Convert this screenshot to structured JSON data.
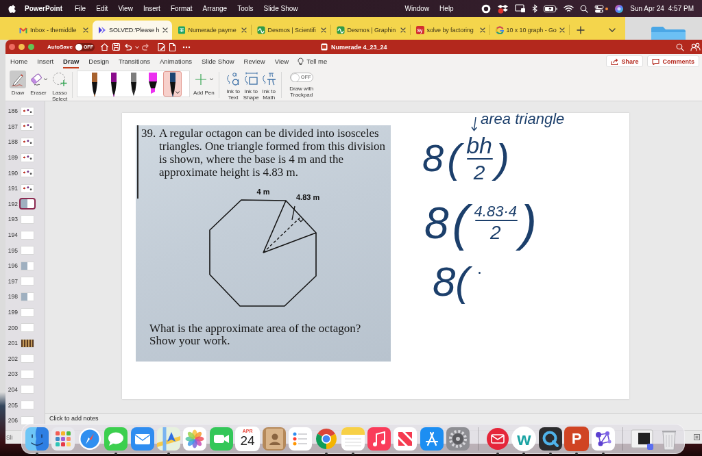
{
  "menubar": {
    "app": "PowerPoint",
    "menus": [
      "File",
      "Edit",
      "View",
      "Insert",
      "Format",
      "Arrange",
      "Tools",
      "Slide Show"
    ],
    "menus_right": [
      "Window",
      "Help"
    ],
    "clock": {
      "date": "Sun Apr 24",
      "time": "4:57 PM"
    }
  },
  "browser_tabs": [
    {
      "title": "Inbox - themiddle",
      "kind": "mail",
      "selected": false
    },
    {
      "title": "SOLVED:'Please h",
      "kind": "video",
      "selected": true
    },
    {
      "title": "Numerade payme",
      "kind": "sheet",
      "selected": false
    },
    {
      "title": "Desmos | Scientifi",
      "kind": "calculator",
      "selected": false
    },
    {
      "title": "Desmos | Graphin",
      "kind": "calculator",
      "selected": false
    },
    {
      "title": "solve by factoring",
      "kind": "badge",
      "badge": "Sy",
      "selected": false
    },
    {
      "title": "10 x 10 graph - Go",
      "kind": "search",
      "selected": false
    }
  ],
  "presentation": {
    "title": "Numerade 4_23_24",
    "autosave": {
      "label": "AutoSave",
      "on": false,
      "state_text": "OFF"
    },
    "ribbon_tabs": [
      {
        "label": "Home",
        "selected": false
      },
      {
        "label": "Insert",
        "selected": false
      },
      {
        "label": "Draw",
        "selected": true
      },
      {
        "label": "Design",
        "selected": false
      },
      {
        "label": "Transitions",
        "selected": false
      },
      {
        "label": "Animations",
        "selected": false
      },
      {
        "label": "Slide Show",
        "selected": false
      },
      {
        "label": "Review",
        "selected": false
      },
      {
        "label": "View",
        "selected": false
      }
    ],
    "tell_me": "Tell me",
    "share": "Share",
    "comments": "Comments",
    "tools": [
      {
        "kind": "draw",
        "label": "Draw",
        "selected": true
      },
      {
        "kind": "eraser",
        "label": "Eraser",
        "selected": false
      },
      {
        "kind": "lasso",
        "label": "Lasso Select",
        "selected": false
      }
    ],
    "pens": [
      {
        "kind": "pen",
        "color": "#a8622e",
        "selected": false
      },
      {
        "kind": "pen",
        "color": "#8a0b8c",
        "selected": false
      },
      {
        "kind": "pencil",
        "color": "#7d7d7d",
        "selected": false
      },
      {
        "kind": "highlighter",
        "color": "#ec2ff0",
        "selected": false
      },
      {
        "kind": "pen",
        "color": "#1d4471",
        "selected": true
      }
    ],
    "add_pen": "Add Pen",
    "ink_tools": [
      {
        "kind": "text",
        "label": "Ink to Text"
      },
      {
        "kind": "shape",
        "label": "Ink to Shape"
      },
      {
        "kind": "math",
        "label": "Ink to Math"
      }
    ],
    "trackpad": {
      "on": false,
      "state_text": "OFF",
      "label": "Draw with Trackpad"
    },
    "thumbnails": [
      {
        "number": "186",
        "kind": "picture",
        "selected": false
      },
      {
        "number": "187",
        "kind": "picture",
        "selected": false
      },
      {
        "number": "188",
        "kind": "picture",
        "selected": false
      },
      {
        "number": "189",
        "kind": "picture",
        "selected": false
      },
      {
        "number": "190",
        "kind": "picture",
        "selected": false
      },
      {
        "number": "191",
        "kind": "picture",
        "selected": false
      },
      {
        "number": "192",
        "kind": "worksheet",
        "selected": true
      },
      {
        "number": "193",
        "kind": "blank",
        "selected": false
      },
      {
        "number": "194",
        "kind": "blank",
        "selected": false
      },
      {
        "number": "195",
        "kind": "blank",
        "selected": false
      },
      {
        "number": "196",
        "kind": "worksheet",
        "selected": false
      },
      {
        "number": "197",
        "kind": "blank",
        "selected": false
      },
      {
        "number": "198",
        "kind": "worksheet",
        "selected": false
      },
      {
        "number": "199",
        "kind": "blank",
        "selected": false
      },
      {
        "number": "200",
        "kind": "blank",
        "selected": false
      },
      {
        "number": "201",
        "kind": "photo",
        "selected": false
      },
      {
        "number": "202",
        "kind": "blank",
        "selected": false
      },
      {
        "number": "203",
        "kind": "blank",
        "selected": false
      },
      {
        "number": "204",
        "kind": "blank",
        "selected": false
      },
      {
        "number": "205",
        "kind": "blank",
        "selected": false
      },
      {
        "number": "206",
        "kind": "blank",
        "selected": false
      }
    ],
    "slide": {
      "worksheet": {
        "number": "39.",
        "question": "A regular octagon can be divided into isosceles triangles. One triangle formed from this division is shown, where the base is 4 m and the approximate height is 4.83 m.",
        "base_label": "4 m",
        "height_label": "4.83 m",
        "prompt": "What is the approximate area of the octagon? Show your work."
      },
      "ink": [
        {
          "kind": "note",
          "text": "area triangle"
        },
        {
          "kind": "fraction",
          "factor": "8",
          "open": "(",
          "numerator": "bh",
          "denominator": "2",
          "close": ")"
        },
        {
          "kind": "fraction",
          "factor": "8",
          "open": "(",
          "numerator": "4.83·4",
          "denominator": "2",
          "close": ")"
        },
        {
          "kind": "text",
          "text": "8(",
          "trailing_dot": true
        }
      ]
    },
    "notes_placeholder": "Click to add notes",
    "status": "Sli"
  },
  "dock": [
    {
      "kind": "finder",
      "running": true
    },
    {
      "kind": "launchpad",
      "running": false
    },
    {
      "kind": "safari",
      "running": false
    },
    {
      "kind": "messages",
      "running": true
    },
    {
      "kind": "mail",
      "running": false
    },
    {
      "kind": "maps",
      "running": true
    },
    {
      "kind": "photos",
      "running": false
    },
    {
      "kind": "facetime",
      "running": false
    },
    {
      "kind": "calendar",
      "month": "APR",
      "day": "24",
      "running": false
    },
    {
      "kind": "contacts",
      "running": false
    },
    {
      "kind": "reminders",
      "running": false
    },
    {
      "kind": "browser",
      "running": true
    },
    {
      "kind": "notes",
      "running": true
    },
    {
      "kind": "music",
      "running": false
    },
    {
      "kind": "news",
      "running": false
    },
    {
      "kind": "appstore",
      "running": false
    },
    {
      "kind": "settings",
      "running": false
    },
    {
      "kind": "separator"
    },
    {
      "kind": "mailclient",
      "running": true
    },
    {
      "kind": "roundel",
      "letter": "w",
      "running": true
    },
    {
      "kind": "player",
      "running": true
    },
    {
      "kind": "tile",
      "letter": "P",
      "running": true
    },
    {
      "kind": "nodes",
      "running": true
    },
    {
      "kind": "separator"
    },
    {
      "kind": "window",
      "running": false
    },
    {
      "kind": "trash",
      "running": false
    }
  ]
}
